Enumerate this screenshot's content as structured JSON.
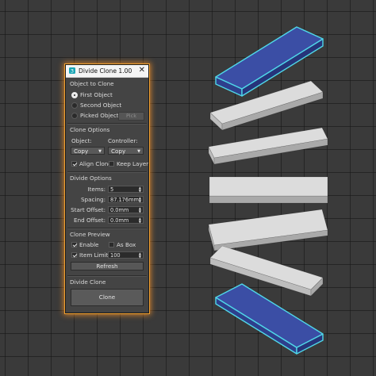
{
  "colors": {
    "selection_outline": "#4fd7e8",
    "selected_face": "#3b4ea5",
    "object_face": "#dcdcdc",
    "panel_glow": "#f0a030"
  },
  "window": {
    "title": "Divide Clone 1.00",
    "app_icon": "3dsmax-icon",
    "close_icon": "close-icon",
    "close_glyph": "✕"
  },
  "object_to_clone": {
    "header": "Object to Clone",
    "options": [
      {
        "label": "First Object",
        "selected": true
      },
      {
        "label": "Second Object",
        "selected": false
      },
      {
        "label": "Picked Object",
        "selected": false
      }
    ],
    "pick_label": "Pick"
  },
  "clone_options": {
    "header": "Clone Options",
    "object_label": "Object:",
    "controller_label": "Controller:",
    "object_value": "Copy",
    "controller_value": "Copy",
    "align_clone_label": "Align Clone",
    "align_clone_checked": true,
    "keep_layer_label": "Keep Layer",
    "keep_layer_checked": false
  },
  "divide_options": {
    "header": "Divide Options",
    "items_label": "Items:",
    "items_value": "5",
    "spacing_label": "Spacing:",
    "spacing_value": "87.176mm",
    "start_offset_label": "Start Offset:",
    "start_offset_value": "0.0mm",
    "end_offset_label": "End Offset:",
    "end_offset_value": "0.0mm"
  },
  "clone_preview": {
    "header": "Clone Preview",
    "enable_label": "Enable",
    "enable_checked": true,
    "as_box_label": "As Box",
    "as_box_checked": false,
    "item_limit_label": "Item Limit",
    "item_limit_checked": true,
    "item_limit_value": "100",
    "refresh_label": "Refresh"
  },
  "divide_clone": {
    "header": "Divide Clone",
    "clone_label": "Clone"
  },
  "viewport": {
    "objects": [
      {
        "name": "first-object",
        "selected": true
      },
      {
        "name": "clone-1",
        "selected": false
      },
      {
        "name": "clone-2",
        "selected": false
      },
      {
        "name": "clone-3",
        "selected": false
      },
      {
        "name": "clone-4",
        "selected": false
      },
      {
        "name": "clone-5",
        "selected": false
      },
      {
        "name": "second-object",
        "selected": true
      }
    ]
  }
}
